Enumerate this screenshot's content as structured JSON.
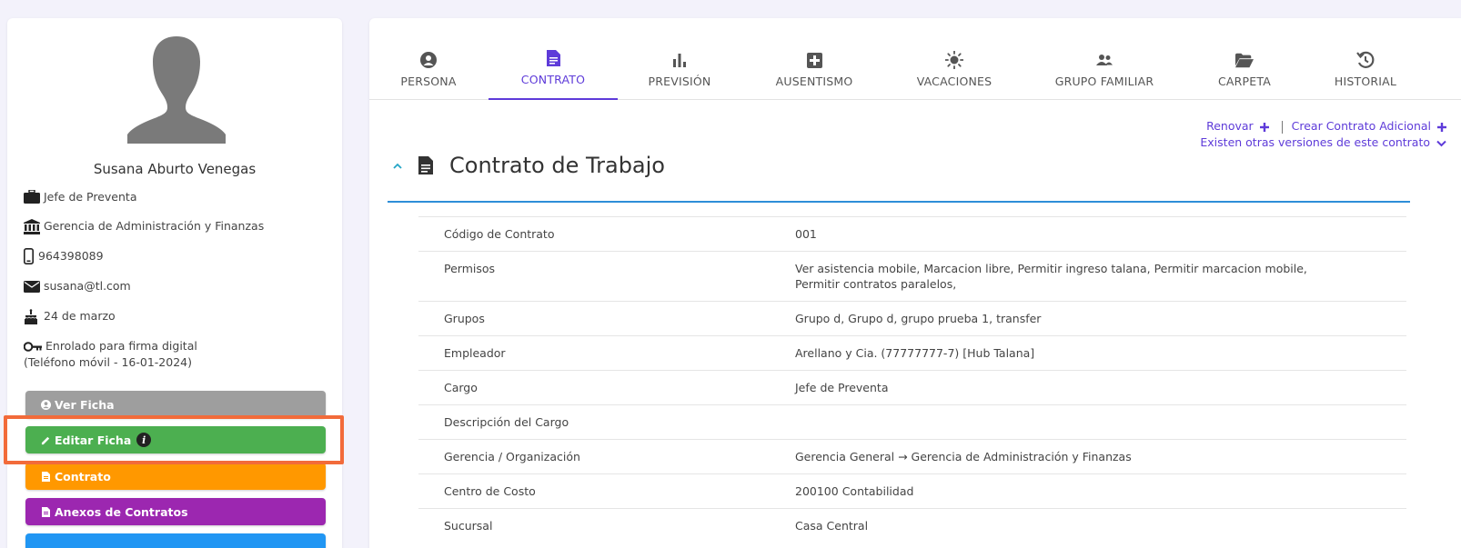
{
  "profile": {
    "name": "Susana Aburto Venegas",
    "position": "Jefe de Preventa",
    "department": "Gerencia de Administración y Finanzas",
    "phone": "964398089",
    "email": "susana@tl.com",
    "birthday": "24 de marzo",
    "signature_line1": "Enrolado para firma digital",
    "signature_line2": "(Teléfono móvil - 16-01-2024)"
  },
  "buttons": {
    "view": "Ver Ficha",
    "edit": "Editar Ficha",
    "contract": "Contrato",
    "annexes": "Anexos de Contratos"
  },
  "tabs": [
    {
      "label": "PERSONA",
      "icon": "person-circle-icon"
    },
    {
      "label": "CONTRATO",
      "icon": "document-icon"
    },
    {
      "label": "PREVISIÓN",
      "icon": "bar-chart-icon"
    },
    {
      "label": "AUSENTISMO",
      "icon": "medical-plus-icon"
    },
    {
      "label": "VACACIONES",
      "icon": "sun-icon"
    },
    {
      "label": "GRUPO FAMILIAR",
      "icon": "people-icon"
    },
    {
      "label": "CARPETA",
      "icon": "folder-open-icon"
    },
    {
      "label": "HISTORIAL",
      "icon": "history-icon"
    }
  ],
  "links": {
    "renew": "Renovar",
    "additional": "Crear Contrato Adicional",
    "versions": "Existen otras versiones de este contrato"
  },
  "section": {
    "title": "Contrato de Trabajo"
  },
  "contract_rows": [
    {
      "label": "Código de Contrato",
      "value": "001"
    },
    {
      "label": "Permisos",
      "value": "Ver asistencia mobile, Marcacion libre, Permitir ingreso talana, Permitir marcacion mobile, Permitir contratos paralelos,"
    },
    {
      "label": "Grupos",
      "value": "Grupo d, Grupo d, grupo prueba 1, transfer"
    },
    {
      "label": "Empleador",
      "value": "Arellano y Cia. (77777777-7) [Hub Talana]"
    },
    {
      "label": "Cargo",
      "value": "Jefe de Preventa"
    },
    {
      "label": "Descripción del Cargo",
      "value": ""
    },
    {
      "label": "Gerencia / Organización",
      "value": "Gerencia General → Gerencia de Administración y Finanzas"
    },
    {
      "label": "Centro de Costo",
      "value": "200100 Contabilidad"
    },
    {
      "label": "Sucursal",
      "value": "Casa Central"
    }
  ],
  "colors": {
    "accent": "#5e3bd9",
    "rule": "#2e8ed8",
    "highlight": "#f26b3a",
    "btn_gray": "#9e9e9e",
    "btn_green": "#4caf50",
    "btn_orange": "#ff9800",
    "btn_purple": "#9c27b0"
  }
}
